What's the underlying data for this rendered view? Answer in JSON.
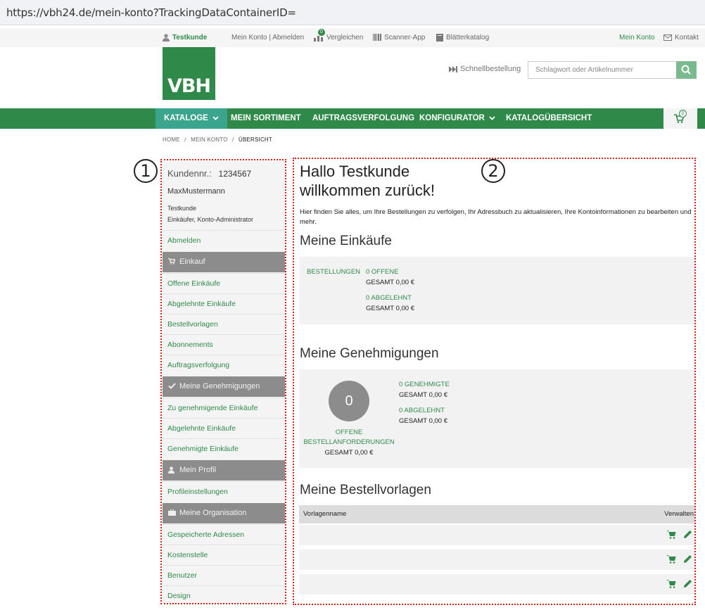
{
  "browser": {
    "url": "https://vbh24.de/mein-konto?TrackingDataContainerID="
  },
  "topbar": {
    "user": "Testkunde",
    "konto_links": "Mein Konto  |  Abmelden",
    "compare": "Vergleichen",
    "compare_badge": "0",
    "scanner": "Scanner-App",
    "catalog": "Blätterkatalog",
    "my_account": "Mein Konto",
    "contact": "Kontakt"
  },
  "logo": {
    "text": "VBH"
  },
  "header": {
    "quick_order": "Schnellbestellung",
    "search_placeholder": "Schlagwort oder Artikelnummer"
  },
  "nav": {
    "items": [
      "KATALOGE",
      "MEIN SORTIMENT",
      "AUFTRAGSVERFOLGUNG",
      "KONFIGURATOR",
      "KATALOGÜBERSICHT"
    ],
    "cart_count": "0"
  },
  "breadcrumb": {
    "home": "HOME",
    "account": "MEIN KONTO",
    "current": "ÜBERSICHT",
    "sep": "/"
  },
  "annotations": {
    "one": "1",
    "two": "2"
  },
  "sidebar": {
    "customer_label": "Kundennr.:",
    "customer_number": "1234567",
    "username": "MaxMustermann",
    "name": "Testkunde",
    "roles": "Einkäufer, Konto-Administrator",
    "logout": "Abmelden",
    "sec_einkauf": "Einkauf",
    "einkauf": [
      "Offene Einkäufe",
      "Abgelehnte Einkäufe",
      "Bestellvorlagen",
      "Abonnements",
      "Auftragsverfolgung"
    ],
    "sec_genehmigungen": "Meine Genehmigungen",
    "genehmigungen": [
      "Zu genehmigende Einkäufe",
      "Abgelehnte Einkäufe",
      "Genehmigte Einkäufe"
    ],
    "sec_profil": "Mein Profil",
    "profil": [
      "Profileinstellungen"
    ],
    "sec_organisation": "Meine Organisation",
    "organisation": [
      "Gespeicherte Adressen",
      "Kostenstelle",
      "Benutzer",
      "Design"
    ]
  },
  "main": {
    "greeting_1": "Hallo Testkunde",
    "greeting_2": "willkommen zurück!",
    "intro": "Hier finden Sie alles, um Ihre Bestellungen zu verfolgen, Ihr Adressbuch zu aktualisieren, Ihre Kontoinformationen zu bearbeiten und mehr.",
    "einkaeufe_title": "Meine Einkäufe",
    "bestellungen_label": "BESTELLUNGEN",
    "offene": "0 OFFENE",
    "offene_total": "GESAMT 0,00 €",
    "abgelehnt": "0 ABGELEHNT",
    "abgelehnt_total": "GESAMT 0,00 €",
    "genehmigungen_title": "Meine Genehmigungen",
    "circle_value": "0",
    "offene_anf_1": "OFFENE",
    "offene_anf_2": "BESTELLANFORDERUNGEN",
    "offene_anf_total": "GESAMT 0,00 €",
    "genehmigte": "0 GENEHMIGTE",
    "genehmigte_total": "GESAMT 0,00 €",
    "gen_abgelehnt": "0 ABGELEHNT",
    "gen_abgelehnt_total": "GESAMT 0,00 €",
    "vorlagen_title": "Meine Bestellvorlagen",
    "col_name": "Vorlagenname",
    "col_manage": "Verwalten"
  },
  "colors": {
    "brand_green": "#2f8a4a",
    "active_nav": "#3aa58c",
    "section_gray": "#8c8c8c",
    "annotation_red": "#d02020"
  }
}
